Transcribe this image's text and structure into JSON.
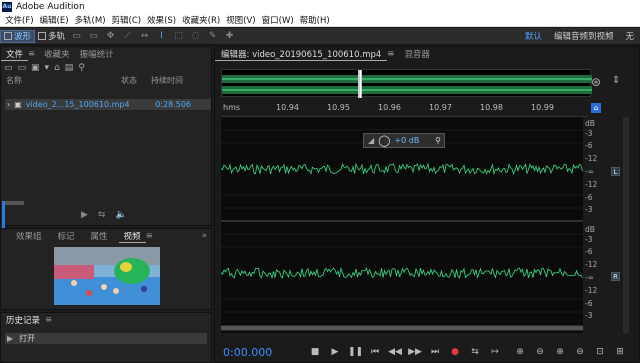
{
  "app": {
    "title": "Adobe Audition",
    "logo_text": "Au"
  },
  "menu": [
    "文件(F)",
    "编辑(E)",
    "多轨(M)",
    "剪辑(C)",
    "效果(S)",
    "收藏夹(R)",
    "视图(V)",
    "窗口(W)",
    "帮助(H)"
  ],
  "toolbar": {
    "waveform_label": "波形",
    "multitrack_label": "多轨",
    "workspaces": [
      "默认",
      "编辑音频到视频",
      "无"
    ]
  },
  "files_panel": {
    "tabs": [
      "文件",
      "收藏夹",
      "振幅统计"
    ],
    "columns": {
      "name": "名称",
      "status": "状态",
      "duration": "持续时间"
    },
    "files": [
      {
        "name": "video_2...15_100610.mp4",
        "duration": "0:28.506"
      }
    ]
  },
  "effects_panel": {
    "tabs": [
      "效果组",
      "标记",
      "属性",
      "视频"
    ]
  },
  "history_panel": {
    "title": "历史记录",
    "items": [
      "打开"
    ]
  },
  "editor": {
    "tabs": [
      "编辑器: video_20190615_100610.mp4",
      "混音器"
    ],
    "ruler_unit": "hms",
    "ruler_ticks": [
      "10.94",
      "10.95",
      "10.96",
      "10.97",
      "10.98",
      "10.99"
    ],
    "hud_gain": "+0 dB",
    "db_scale_top": [
      "dB",
      "-3",
      "-6",
      "-12",
      "-∞",
      "-12",
      "-6",
      "-3"
    ],
    "db_scale_bottom": [
      "dB",
      "-3",
      "-6",
      "-12",
      "-∞",
      "-12",
      "-6",
      "-3"
    ],
    "channel_left": "L",
    "channel_right": "R",
    "timecode": "0:00.000"
  },
  "colors": {
    "accent": "#3b8fff",
    "waveform": "#3ddc84",
    "menu_bg": "#ffffff"
  }
}
